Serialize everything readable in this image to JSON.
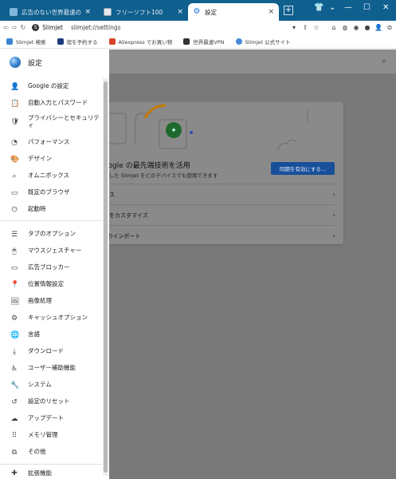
{
  "browser": {
    "tabs": [
      {
        "title": "広告のない世界最速のウェブブ",
        "close": "×"
      },
      {
        "title": "フリーソフト100",
        "close": "×"
      },
      {
        "title": "設定",
        "close": "×"
      }
    ],
    "new_tab": "+",
    "window_controls": {
      "minimize": "—",
      "maximize": "☐",
      "close": "✕"
    }
  },
  "toolbar": {
    "back": "⇦",
    "forward": "⇨",
    "reload": "↻",
    "site_name": "Slimjet",
    "url": "slimjet://settings"
  },
  "bookmarks": [
    {
      "label": "Slimjet 検索",
      "color": "#3a86d4"
    },
    {
      "label": "宿を予約する",
      "color": "#1d3a7a"
    },
    {
      "label": "Aliexpress でお買い物",
      "color": "#d9432b"
    },
    {
      "label": "世界最速VPN",
      "color": "#333333"
    },
    {
      "label": "Slimjet 公式サイト",
      "color": "#4a8bd8"
    }
  ],
  "sidebar": {
    "title": "設定",
    "items": [
      {
        "label": "Google の設定",
        "icon": "person-icon",
        "glyph": "👤"
      },
      {
        "label": "自動入力とパスワード",
        "icon": "clipboard-icon",
        "glyph": "📋"
      },
      {
        "label": "プライバシーとセキュリティ",
        "icon": "shield-icon",
        "glyph": "🛡"
      },
      {
        "label": "パフォーマンス",
        "icon": "speedometer-icon",
        "glyph": "◔"
      },
      {
        "label": "デザイン",
        "icon": "palette-icon",
        "glyph": "🎨"
      },
      {
        "label": "オムニボックス",
        "icon": "search-icon",
        "glyph": "⌕"
      },
      {
        "label": "既定のブラウザ",
        "icon": "browser-icon",
        "glyph": "▭"
      },
      {
        "label": "起動時",
        "icon": "power-icon",
        "glyph": "⏻"
      },
      {
        "label": "タブのオプション",
        "icon": "list-icon",
        "glyph": "☰"
      },
      {
        "label": "マウスジェスチャー",
        "icon": "mouse-icon",
        "glyph": "🖱"
      },
      {
        "label": "広告ブロッカー",
        "icon": "ad-block-icon",
        "glyph": "▭"
      },
      {
        "label": "位置情報設定",
        "icon": "location-pin-icon",
        "glyph": "📍"
      },
      {
        "label": "画像処理",
        "icon": "image-icon",
        "glyph": "🖼"
      },
      {
        "label": "キャッシュオプション",
        "icon": "gear-icon",
        "glyph": "⚙"
      },
      {
        "label": "言語",
        "icon": "globe-icon",
        "glyph": "🌐"
      },
      {
        "label": "ダウンロード",
        "icon": "download-icon",
        "glyph": "⤓"
      },
      {
        "label": "ユーザー補助機能",
        "icon": "accessibility-icon",
        "glyph": "♿"
      },
      {
        "label": "システム",
        "icon": "wrench-icon",
        "glyph": "🔧"
      },
      {
        "label": "設定のリセット",
        "icon": "history-icon",
        "glyph": "↺"
      },
      {
        "label": "アップデート",
        "icon": "cloud-icon",
        "glyph": "☁"
      },
      {
        "label": "メモリ管理",
        "icon": "grid-icon",
        "glyph": "⠿"
      },
      {
        "label": "その他",
        "icon": "copy-icon",
        "glyph": "⧉"
      }
    ],
    "footer_partial": "拡張機能"
  },
  "main": {
    "search_icon": "search-icon",
    "card": {
      "title": "oogle の最先端技術を活用",
      "subtitle": "ズした Slimjet をどのデバイスでも使用できます",
      "sync_button": "同期を有効にする...",
      "rows": [
        {
          "label": "ビス"
        },
        {
          "label": "ムをカスタマイズ"
        },
        {
          "label": "Eのインポート"
        }
      ]
    }
  }
}
